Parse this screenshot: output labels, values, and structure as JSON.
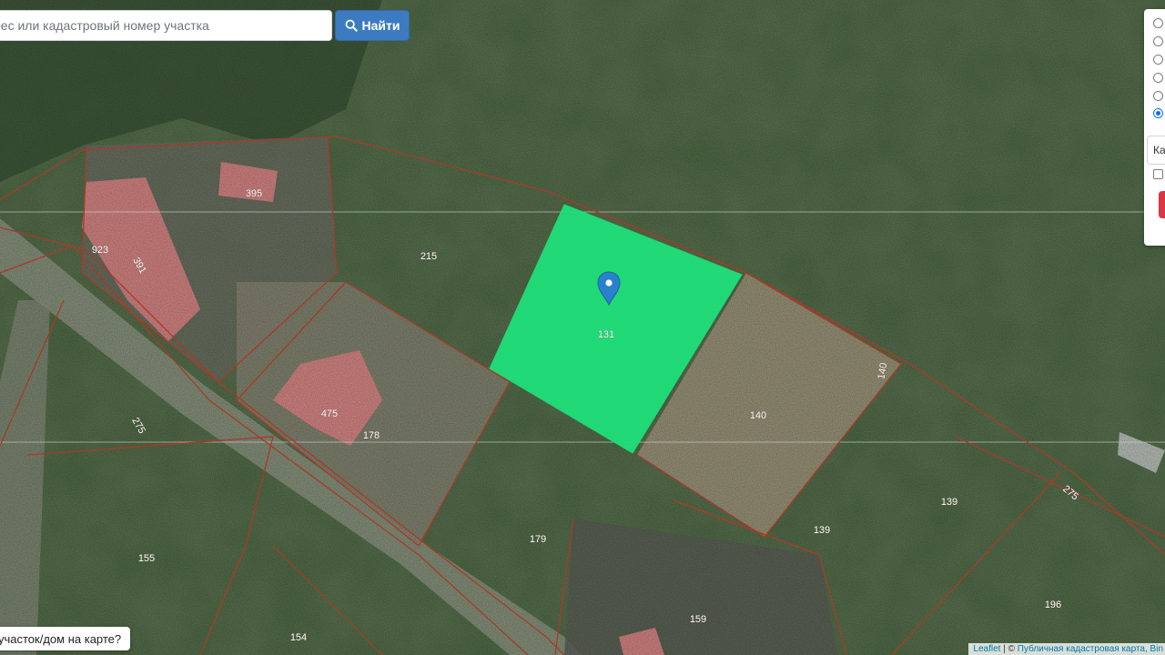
{
  "search": {
    "placeholder": "рес или кадастровый номер участка",
    "button_label": "Найти",
    "button_icon": "search-icon"
  },
  "map": {
    "selected_parcel": "131",
    "marker_icon": "map-pin-icon",
    "parcel_labels": [
      {
        "text": "395",
        "id": "395"
      },
      {
        "text": "923",
        "id": "923"
      },
      {
        "text": "391",
        "id": "391"
      },
      {
        "text": "215",
        "id": "215"
      },
      {
        "text": "131",
        "id": "131"
      },
      {
        "text": "475",
        "id": "475"
      },
      {
        "text": "178",
        "id": "178"
      },
      {
        "text": "275",
        "id": "275-left"
      },
      {
        "text": "140",
        "id": "140-edge"
      },
      {
        "text": "140",
        "id": "140"
      },
      {
        "text": "179",
        "id": "179"
      },
      {
        "text": "139",
        "id": "139-a"
      },
      {
        "text": "139",
        "id": "139-b"
      },
      {
        "text": "275",
        "id": "275-right"
      },
      {
        "text": "155",
        "id": "155"
      },
      {
        "text": "159",
        "id": "159"
      },
      {
        "text": "154",
        "id": "154"
      },
      {
        "text": "196",
        "id": "196"
      }
    ],
    "colors": {
      "selected_parcel_fill": "#1fe07a",
      "building_fill": "#e38a8a",
      "parcel_border": "#a83a2a",
      "marker": "#2a81cb"
    }
  },
  "layer_panel": {
    "options_count": 6,
    "checked_index": 5,
    "select_value": "Ка"
  },
  "bottom_button": {
    "label": "участок/дом на карте?"
  },
  "attribution": {
    "leaflet": "Leaflet",
    "separator": " | © ",
    "source": "Публичная кадастровая карта, Bin"
  }
}
